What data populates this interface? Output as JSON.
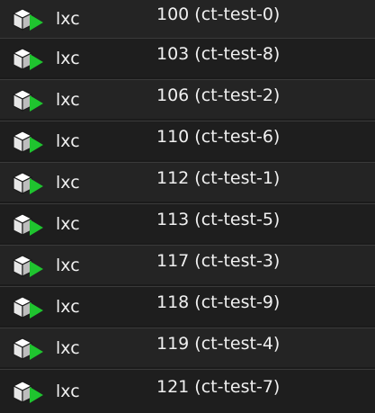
{
  "colors": {
    "status_running": "#1fc42f",
    "text": "#f0f0f0"
  },
  "rows": [
    {
      "icon": "container-running-icon",
      "type": "lxc",
      "name": "100 (ct-test-0)"
    },
    {
      "icon": "container-running-icon",
      "type": "lxc",
      "name": "103 (ct-test-8)"
    },
    {
      "icon": "container-running-icon",
      "type": "lxc",
      "name": "106 (ct-test-2)"
    },
    {
      "icon": "container-running-icon",
      "type": "lxc",
      "name": "110 (ct-test-6)"
    },
    {
      "icon": "container-running-icon",
      "type": "lxc",
      "name": "112 (ct-test-1)"
    },
    {
      "icon": "container-running-icon",
      "type": "lxc",
      "name": "113 (ct-test-5)"
    },
    {
      "icon": "container-running-icon",
      "type": "lxc",
      "name": "117 (ct-test-3)"
    },
    {
      "icon": "container-running-icon",
      "type": "lxc",
      "name": "118 (ct-test-9)"
    },
    {
      "icon": "container-running-icon",
      "type": "lxc",
      "name": "119 (ct-test-4)"
    },
    {
      "icon": "container-running-icon",
      "type": "lxc",
      "name": "121 (ct-test-7)"
    }
  ]
}
